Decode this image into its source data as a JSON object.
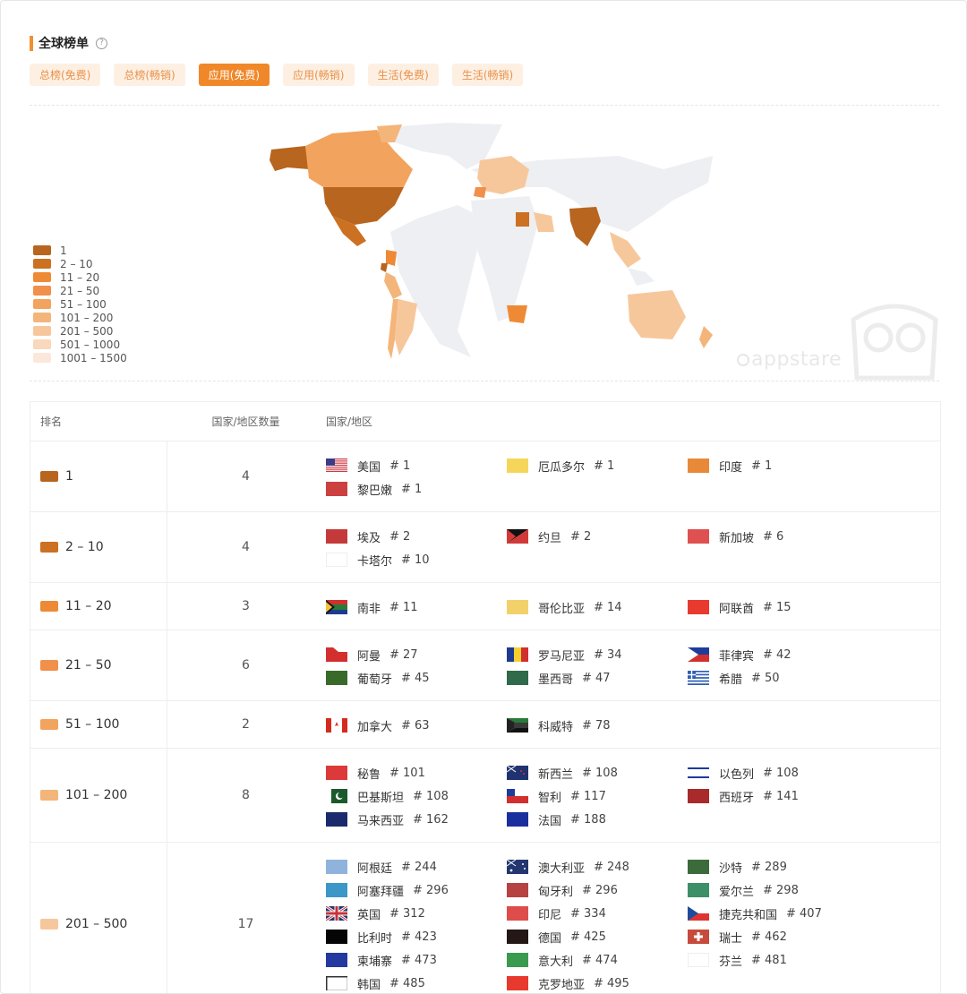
{
  "header": {
    "title": "全球榜单",
    "help_icon": "help-circle-icon"
  },
  "tabs": [
    {
      "label": "总榜(免费)",
      "active": false
    },
    {
      "label": "总榜(畅销)",
      "active": false
    },
    {
      "label": "应用(免费)",
      "active": true
    },
    {
      "label": "应用(畅销)",
      "active": false
    },
    {
      "label": "生活(免费)",
      "active": false
    },
    {
      "label": "生活(畅销)",
      "active": false
    }
  ],
  "watermark": {
    "text": "appstare"
  },
  "legend": [
    {
      "label": "1",
      "color": "#b7651f"
    },
    {
      "label": "2 – 10",
      "color": "#cc7022"
    },
    {
      "label": "11 – 20",
      "color": "#ee8a35"
    },
    {
      "label": "21 – 50",
      "color": "#f0904b"
    },
    {
      "label": "51 – 100",
      "color": "#f2a35e"
    },
    {
      "label": "101 – 200",
      "color": "#f4b57a"
    },
    {
      "label": "201 – 500",
      "color": "#f7c79c"
    },
    {
      "label": "501 – 1000",
      "color": "#f9d8bd"
    },
    {
      "label": "1001 – 1500",
      "color": "#fce8da"
    }
  ],
  "table": {
    "headers": {
      "rank": "排名",
      "count": "国家/地区数量",
      "countries": "国家/地区"
    },
    "rows": [
      {
        "rank": "1",
        "count": "4",
        "color": "#b7651f",
        "countries": [
          {
            "name": "美国",
            "rank": "# 1",
            "flag": "us"
          },
          {
            "name": "厄瓜多尔",
            "rank": "# 1",
            "flag": "ec"
          },
          {
            "name": "印度",
            "rank": "# 1",
            "flag": "in"
          },
          {
            "name": "黎巴嫩",
            "rank": "# 1",
            "flag": "lb"
          }
        ]
      },
      {
        "rank": "2 – 10",
        "count": "4",
        "color": "#cc7022",
        "countries": [
          {
            "name": "埃及",
            "rank": "# 2",
            "flag": "eg"
          },
          {
            "name": "约旦",
            "rank": "# 2",
            "flag": "jo"
          },
          {
            "name": "新加坡",
            "rank": "# 6",
            "flag": "sg"
          },
          {
            "name": "卡塔尔",
            "rank": "# 10",
            "flag": "qa"
          }
        ]
      },
      {
        "rank": "11 – 20",
        "count": "3",
        "color": "#ee8a35",
        "countries": [
          {
            "name": "南非",
            "rank": "# 11",
            "flag": "za"
          },
          {
            "name": "哥伦比亚",
            "rank": "# 14",
            "flag": "co"
          },
          {
            "name": "阿联酋",
            "rank": "# 15",
            "flag": "ae"
          }
        ]
      },
      {
        "rank": "21 – 50",
        "count": "6",
        "color": "#f0904b",
        "countries": [
          {
            "name": "阿曼",
            "rank": "# 27",
            "flag": "om"
          },
          {
            "name": "罗马尼亚",
            "rank": "# 34",
            "flag": "ro"
          },
          {
            "name": "菲律宾",
            "rank": "# 42",
            "flag": "ph"
          },
          {
            "name": "葡萄牙",
            "rank": "# 45",
            "flag": "pt"
          },
          {
            "name": "墨西哥",
            "rank": "# 47",
            "flag": "mx"
          },
          {
            "name": "希腊",
            "rank": "# 50",
            "flag": "gr"
          }
        ]
      },
      {
        "rank": "51 – 100",
        "count": "2",
        "color": "#f2a35e",
        "countries": [
          {
            "name": "加拿大",
            "rank": "# 63",
            "flag": "ca"
          },
          {
            "name": "科威特",
            "rank": "# 78",
            "flag": "kw"
          }
        ]
      },
      {
        "rank": "101 – 200",
        "count": "8",
        "color": "#f4b57a",
        "countries": [
          {
            "name": "秘鲁",
            "rank": "# 101",
            "flag": "pe"
          },
          {
            "name": "新西兰",
            "rank": "# 108",
            "flag": "nz"
          },
          {
            "name": "以色列",
            "rank": "# 108",
            "flag": "il"
          },
          {
            "name": "巴基斯坦",
            "rank": "# 108",
            "flag": "pk"
          },
          {
            "name": "智利",
            "rank": "# 117",
            "flag": "cl"
          },
          {
            "name": "西班牙",
            "rank": "# 141",
            "flag": "es"
          },
          {
            "name": "马来西亚",
            "rank": "# 162",
            "flag": "my"
          },
          {
            "name": "法国",
            "rank": "# 188",
            "flag": "fr"
          }
        ]
      },
      {
        "rank": "201 – 500",
        "count": "17",
        "color": "#f7c79c",
        "countries": [
          {
            "name": "阿根廷",
            "rank": "# 244",
            "flag": "ar"
          },
          {
            "name": "澳大利亚",
            "rank": "# 248",
            "flag": "au"
          },
          {
            "name": "沙特",
            "rank": "# 289",
            "flag": "sa"
          },
          {
            "name": "阿塞拜疆",
            "rank": "# 296",
            "flag": "az"
          },
          {
            "name": "匈牙利",
            "rank": "# 296",
            "flag": "hu"
          },
          {
            "name": "爱尔兰",
            "rank": "# 298",
            "flag": "ie"
          },
          {
            "name": "英国",
            "rank": "# 312",
            "flag": "gb"
          },
          {
            "name": "印尼",
            "rank": "# 334",
            "flag": "id"
          },
          {
            "name": "捷克共和国",
            "rank": "# 407",
            "flag": "cz"
          },
          {
            "name": "比利时",
            "rank": "# 423",
            "flag": "be"
          },
          {
            "name": "德国",
            "rank": "# 425",
            "flag": "de"
          },
          {
            "name": "瑞士",
            "rank": "# 462",
            "flag": "ch"
          },
          {
            "name": "柬埔寨",
            "rank": "# 473",
            "flag": "kh"
          },
          {
            "name": "意大利",
            "rank": "# 474",
            "flag": "it"
          },
          {
            "name": "芬兰",
            "rank": "# 481",
            "flag": "fi"
          },
          {
            "name": "韩国",
            "rank": "# 485",
            "flag": "kr"
          },
          {
            "name": "克罗地亚",
            "rank": "# 495",
            "flag": "hr"
          }
        ]
      }
    ]
  }
}
